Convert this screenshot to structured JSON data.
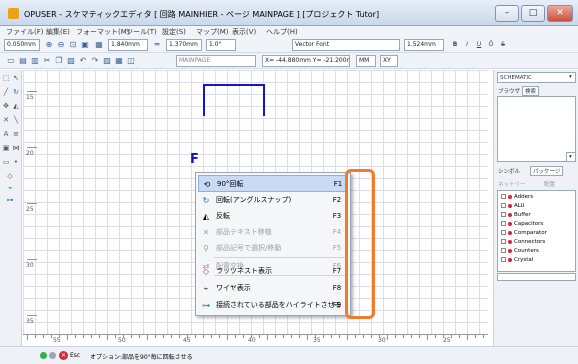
{
  "window": {
    "title": "OPUSER - スケマティックエディタ [ 回路 MAINHIER - ページ MAINPAGE ] [プロジェクト Tutor]",
    "controls": {
      "minimize": "–",
      "maximize": "□",
      "close": "✕"
    }
  },
  "menubar": [
    "ファイル(F)",
    "編集(E)",
    "フォーマット(M)",
    "ツール(T)",
    "設定(S)",
    "マップ(M)",
    "表示(V)",
    "ヘルプ(H)"
  ],
  "toolbar1": {
    "unit_value": "0.050mm",
    "grid_value": "1.840mm",
    "line_value": "1.370mm",
    "angle_value": "1.0°",
    "font_value": "Vector Font",
    "font_size": "1.524mm",
    "bold": "B",
    "italic": "I",
    "underline": "U",
    "overline": "Ō",
    "strike": "S"
  },
  "toolbar2": {
    "page_field": "MAINPAGE",
    "coords": "X= -44.880mm  Y= -21.200mm",
    "mm_btn": "MM",
    "xy_btn": "XY"
  },
  "rulers": {
    "vertical": [
      "15",
      "20",
      "25",
      "30",
      "35"
    ],
    "horizontal": [
      "55",
      "50",
      "45",
      "40",
      "35",
      "30",
      "25"
    ]
  },
  "canvas": {
    "blue_glyph": "F"
  },
  "context_menu": [
    {
      "label": "90°回転",
      "shortcut": "F1",
      "icon": "rotate-90-icon",
      "disabled": false,
      "highlight": true
    },
    {
      "label": "回転(アングルスナップ)",
      "shortcut": "F2",
      "icon": "rotate-snap-icon",
      "disabled": false,
      "highlight": false
    },
    {
      "label": "反転",
      "shortcut": "F3",
      "icon": "mirror-icon",
      "disabled": false,
      "highlight": false
    },
    {
      "label": "部品テキスト移植",
      "shortcut": "F4",
      "icon": "text-move-icon",
      "disabled": true,
      "highlight": false
    },
    {
      "label": "部品記号で選択/移動",
      "shortcut": "F5",
      "icon": "symbol-select-icon",
      "disabled": true,
      "highlight": false
    },
    {
      "label": "配置交換",
      "shortcut": "F6",
      "icon": "swap-icon",
      "disabled": true,
      "highlight": false
    },
    {
      "label": "ラッツネスト表示",
      "shortcut": "F7",
      "icon": "ratsnest-icon",
      "disabled": false,
      "highlight": false
    },
    {
      "label": "ワイヤ表示",
      "shortcut": "F8",
      "icon": "wire-icon",
      "disabled": false,
      "highlight": false
    },
    {
      "label": "接続されている部品をハイライトさせる",
      "shortcut": "F9",
      "icon": "highlight-connected-icon",
      "disabled": false,
      "highlight": false
    }
  ],
  "right_panel": {
    "schematic_select": "SCHEMATIC",
    "tab_browser": "ブラウザ",
    "tab_search": "検索",
    "tab_symbol": "シンボル",
    "tab_package": "パッケージ",
    "netlist_btn": "ネットリー",
    "place_btn": "配置",
    "tree": [
      "Adders",
      "ALU",
      "Buffer",
      "Capacitors",
      "Comparator",
      "Connectors",
      "Counters",
      "Crystal"
    ]
  },
  "status": {
    "esc_label": "Esc",
    "message": "オプション:部品を90°毎に回転させる"
  },
  "colors": {
    "accent": "#ee7c28",
    "wire": "#1313c9",
    "highlight": "#c9daf5"
  }
}
